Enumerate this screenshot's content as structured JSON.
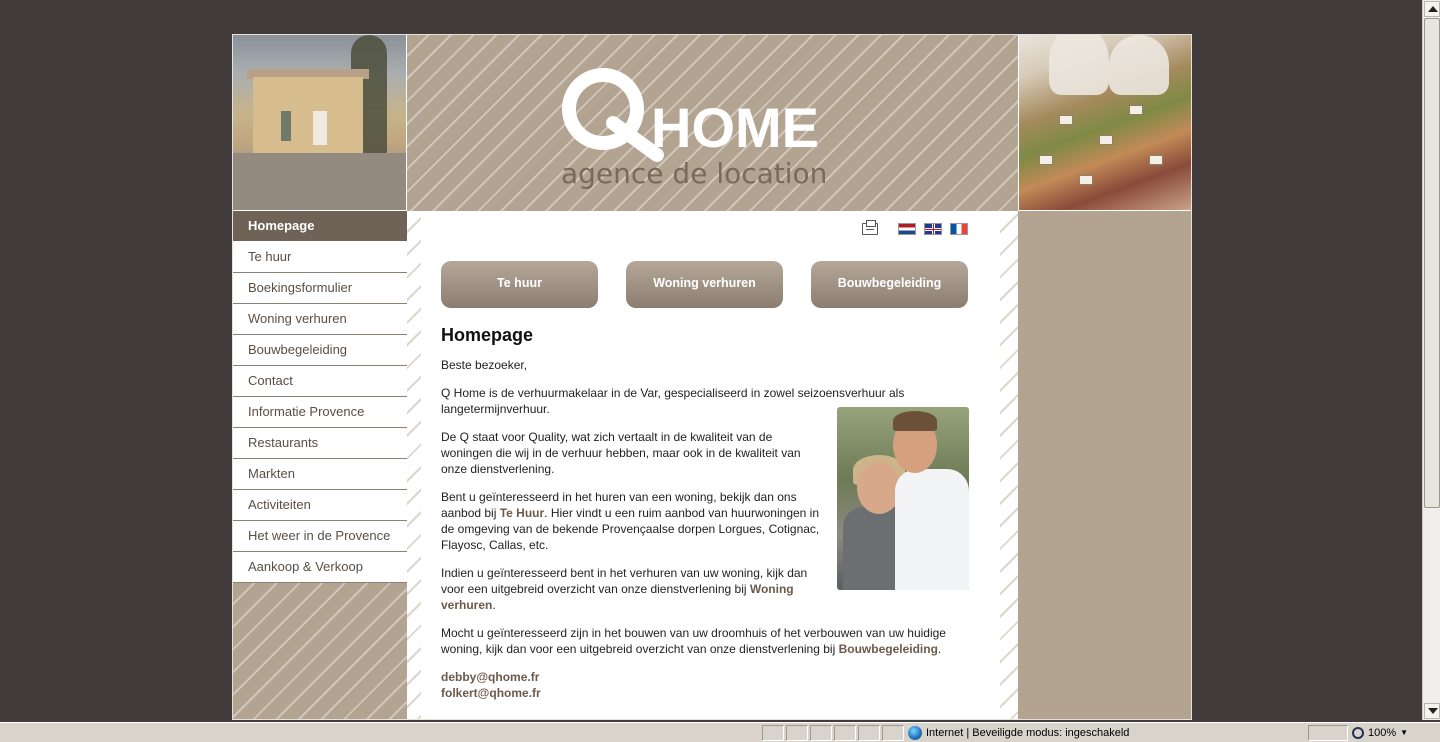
{
  "logo": {
    "brand": "HOME",
    "tagline": "agence de location"
  },
  "nav": {
    "items": [
      {
        "label": "Homepage",
        "active": true
      },
      {
        "label": "Te huur"
      },
      {
        "label": "Boekingsformulier"
      },
      {
        "label": "Woning verhuren"
      },
      {
        "label": "Bouwbegeleiding"
      },
      {
        "label": "Contact"
      },
      {
        "label": "Informatie Provence"
      },
      {
        "label": "Restaurants"
      },
      {
        "label": "Markten"
      },
      {
        "label": "Activiteiten"
      },
      {
        "label": "Het weer in de Provence"
      },
      {
        "label": "Aankoop & Verkoop"
      }
    ]
  },
  "buttons": {
    "te_huur": "Te huur",
    "woning_verhuren": "Woning verhuren",
    "bouwbegeleiding": "Bouwbegeleiding"
  },
  "content": {
    "title": "Homepage",
    "greeting": "Beste bezoeker,",
    "p1": "Q Home is de verhuurmakelaar in de Var, gespecialiseerd in zowel seizoensverhuur als langetermijnverhuur.",
    "p2": "De Q staat voor Quality, wat zich vertaalt in de kwaliteit van de woningen die wij in de verhuur hebben, maar ook in de kwaliteit van onze dienstverlening.",
    "p3_a": "Bent u geïnteresseerd in het huren van een woning, bekijk dan ons aanbod bij ",
    "p3_link": "Te Huur",
    "p3_b": ". Hier vindt u een ruim aanbod van huurwoningen in de omgeving van de bekende Provençaalse dorpen Lorgues, Cotignac, Flayosc, Callas, etc.",
    "p4_a": "Indien u geïnteresseerd bent in het verhuren van uw woning, kijk dan voor een uitgebreid overzicht van onze dienstverlening bij ",
    "p4_link": "Woning verhuren",
    "p4_b": ".",
    "p5_a": "Mocht u geïnteresseerd zijn in het bouwen van uw droomhuis of het verbouwen van uw huidige woning, kijk dan voor een uitgebreid overzicht van onze dienstverlening bij ",
    "p5_link": "Bouwbegeleiding",
    "p5_b": ".",
    "email1": "debby@qhome.fr",
    "email2": "folkert@qhome.fr"
  },
  "statusbar": {
    "zone": "Internet | Beveiligde modus: ingeschakeld",
    "zoom": "100%"
  },
  "colors": {
    "background": "#413c3b",
    "stripe": "#b3a391",
    "nav_active": "#6f6357",
    "link": "#6b5a4a"
  }
}
